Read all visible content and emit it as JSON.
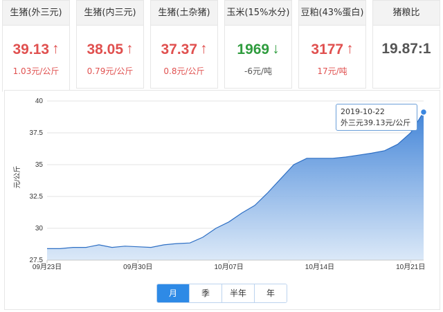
{
  "cards": [
    {
      "title": "生猪(外三元)",
      "price": "39.13",
      "change": "1.03元/公斤",
      "direction": "up"
    },
    {
      "title": "生猪(内三元)",
      "price": "38.05",
      "change": "0.79元/公斤",
      "direction": "up"
    },
    {
      "title": "生猪(土杂猪)",
      "price": "37.37",
      "change": "0.8元/公斤",
      "direction": "up"
    },
    {
      "title": "玉米(15%水分)",
      "price": "1969",
      "change": "-6元/吨",
      "direction": "down"
    },
    {
      "title": "豆粕(43%蛋白)",
      "price": "3177",
      "change": "17元/吨",
      "direction": "up"
    },
    {
      "title": "猪粮比",
      "price": "19.87:1",
      "change": "",
      "direction": "none"
    }
  ],
  "colors": {
    "up": "#e0504f",
    "down": "#2f9c3e",
    "accent": "#2e8ae6"
  },
  "tooltip": {
    "date": "2019-10-22",
    "value": "外三元39.13元/公斤"
  },
  "range_tabs": [
    {
      "label": "月",
      "selected": true
    },
    {
      "label": "季",
      "selected": false
    },
    {
      "label": "半年",
      "selected": false
    },
    {
      "label": "年",
      "selected": false
    }
  ],
  "chart_data": {
    "type": "area",
    "ylabel": "元/公斤",
    "ylim": [
      27.5,
      40
    ],
    "yticks": [
      "27.5",
      "30",
      "32.5",
      "35",
      "37.5",
      "40"
    ],
    "xtick_labels": [
      "09月23日",
      "09月30日",
      "10月07日",
      "10月14日",
      "10月21日"
    ],
    "xlim": [
      "2019-09-23",
      "2019-10-22"
    ],
    "series": [
      {
        "values": [
          {
            "x": "2019-09-23",
            "y": 28.4
          },
          {
            "x": "2019-09-24",
            "y": 28.4
          },
          {
            "x": "2019-09-25",
            "y": 28.5
          },
          {
            "x": "2019-09-26",
            "y": 28.5
          },
          {
            "x": "2019-09-27",
            "y": 28.7
          },
          {
            "x": "2019-09-28",
            "y": 28.5
          },
          {
            "x": "2019-09-29",
            "y": 28.6
          },
          {
            "x": "2019-09-30",
            "y": 28.55
          },
          {
            "x": "2019-10-01",
            "y": 28.5
          },
          {
            "x": "2019-10-02",
            "y": 28.7
          },
          {
            "x": "2019-10-03",
            "y": 28.8
          },
          {
            "x": "2019-10-04",
            "y": 28.85
          },
          {
            "x": "2019-10-05",
            "y": 29.3
          },
          {
            "x": "2019-10-06",
            "y": 30.0
          },
          {
            "x": "2019-10-07",
            "y": 30.5
          },
          {
            "x": "2019-10-08",
            "y": 31.2
          },
          {
            "x": "2019-10-09",
            "y": 31.8
          },
          {
            "x": "2019-10-10",
            "y": 32.8
          },
          {
            "x": "2019-10-11",
            "y": 33.9
          },
          {
            "x": "2019-10-12",
            "y": 35.0
          },
          {
            "x": "2019-10-13",
            "y": 35.5
          },
          {
            "x": "2019-10-14",
            "y": 35.5
          },
          {
            "x": "2019-10-15",
            "y": 35.5
          },
          {
            "x": "2019-10-16",
            "y": 35.6
          },
          {
            "x": "2019-10-17",
            "y": 35.75
          },
          {
            "x": "2019-10-18",
            "y": 35.9
          },
          {
            "x": "2019-10-19",
            "y": 36.1
          },
          {
            "x": "2019-10-20",
            "y": 36.6
          },
          {
            "x": "2019-10-21",
            "y": 37.5
          },
          {
            "x": "2019-10-22",
            "y": 39.13
          }
        ]
      }
    ],
    "grid": true,
    "highlight_index": 29
  }
}
